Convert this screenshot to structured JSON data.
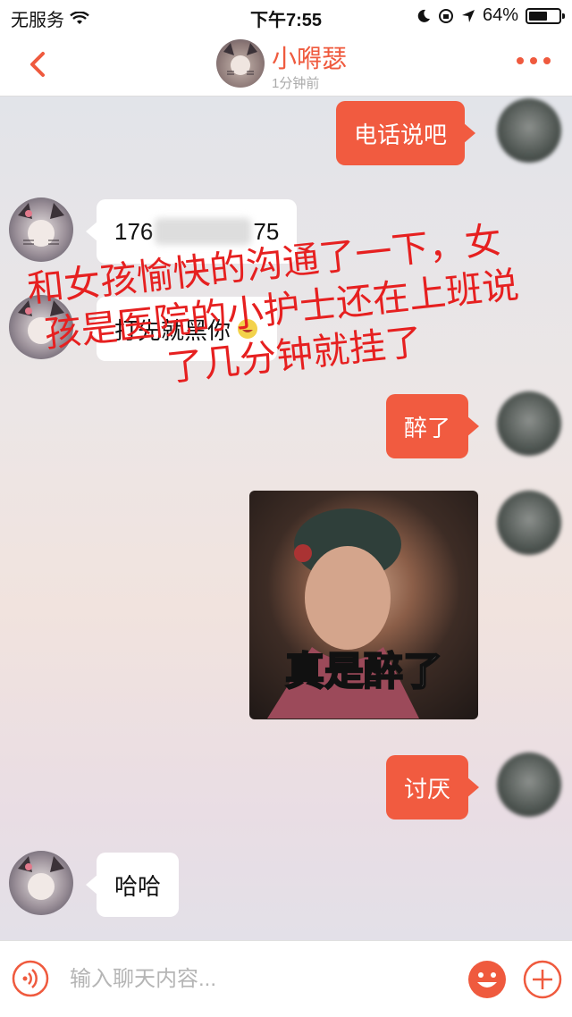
{
  "status_bar": {
    "carrier": "无服务",
    "time": "下午7:55",
    "battery_percent": "64%",
    "battery_level": 0.64
  },
  "header": {
    "contact_name": "小嘚瑟",
    "last_seen": "1分钟前"
  },
  "messages": [
    {
      "direction": "out",
      "type": "text",
      "text": "电话说吧"
    },
    {
      "direction": "in",
      "type": "text",
      "text_prefix": "176",
      "text_suffix": "75"
    },
    {
      "direction": "in",
      "type": "text",
      "text": "打先就黑你"
    },
    {
      "direction": "out",
      "type": "text",
      "text": "醉了"
    },
    {
      "direction": "out",
      "type": "image",
      "caption": "真是醉了"
    },
    {
      "direction": "out",
      "type": "text",
      "text": "讨厌"
    },
    {
      "direction": "in",
      "type": "text",
      "text": "哈哈"
    }
  ],
  "annotation": {
    "line1": "和女孩愉快的沟通了一下，女",
    "line2": "孩是医院的小护士还在上班说",
    "line3": "了几分钟就挂了"
  },
  "input_bar": {
    "placeholder": "输入聊天内容..."
  },
  "colors": {
    "accent": "#f15b40",
    "annotation": "#e62020"
  }
}
